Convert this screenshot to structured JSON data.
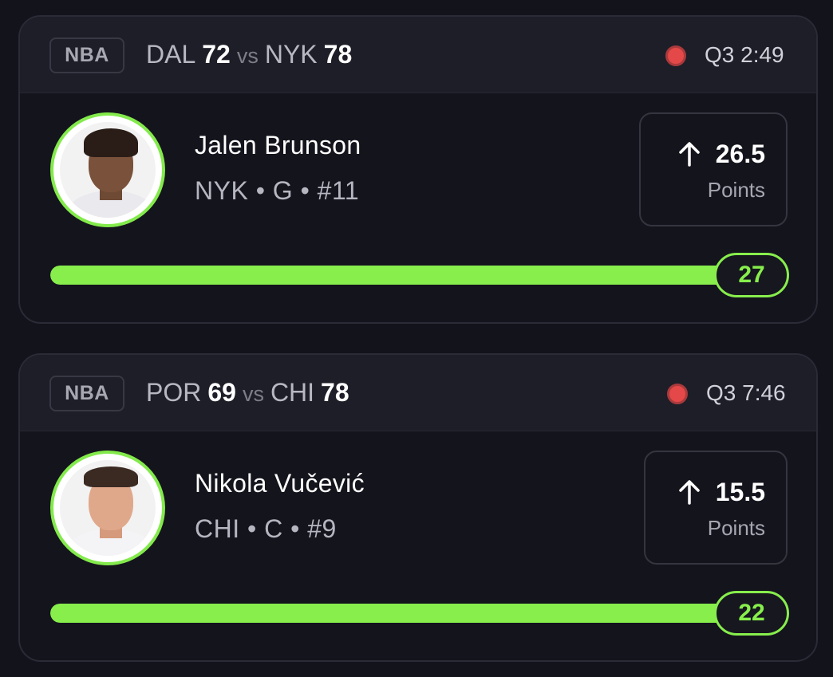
{
  "cards": [
    {
      "league": "NBA",
      "away_team": "DAL",
      "away_score": "72",
      "vs": "vs",
      "home_team": "NYK",
      "home_score": "78",
      "clock": "Q3 2:49",
      "player_name": "Jalen Brunson",
      "player_meta": "NYK • G • #11",
      "direction": "up-arrow-icon",
      "line_value": "26.5",
      "line_stat": "Points",
      "current_value": "27",
      "progress_fraction": 1.0
    },
    {
      "league": "NBA",
      "away_team": "POR",
      "away_score": "69",
      "vs": "vs",
      "home_team": "CHI",
      "home_score": "78",
      "clock": "Q3 7:46",
      "player_name": "Nikola Vučević",
      "player_meta": "CHI • C • #9",
      "direction": "up-arrow-icon",
      "line_value": "15.5",
      "line_stat": "Points",
      "current_value": "22",
      "progress_fraction": 1.0
    }
  ],
  "colors": {
    "accent": "#87ee4c",
    "live": "#e54848",
    "background": "#13131c"
  }
}
